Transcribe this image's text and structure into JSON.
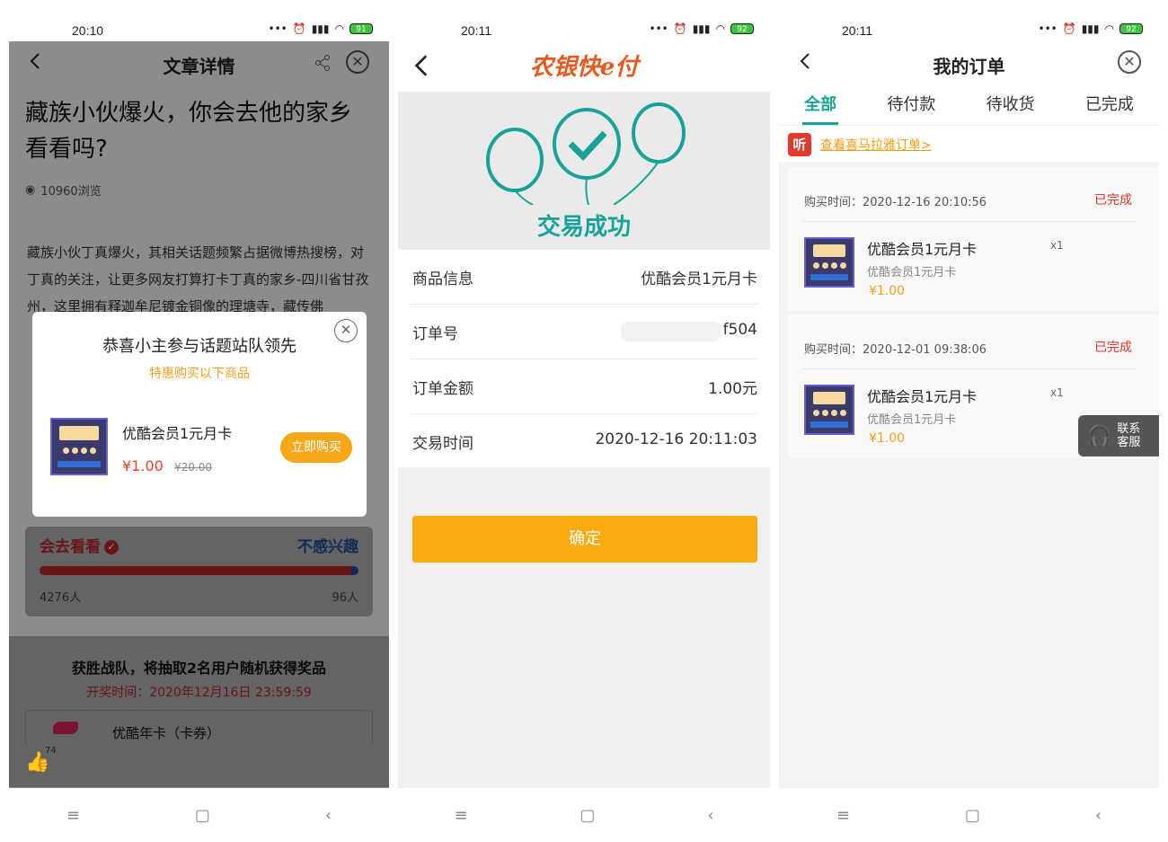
{
  "phone1": {
    "status": {
      "time": "20:10",
      "battery": "91"
    },
    "nav": {
      "title": "文章详情"
    },
    "headline": "藏族小伙爆火，你会去他的家乡看看吗?",
    "views": "10960浏览",
    "body": "藏族小伙丁真爆火，其相关话题频繁占据微博热搜榜，对丁真的关注，让更多网友打算打卡丁真的家乡-四川省甘孜州，这里拥有释迦牟尼镀金铜像的理塘寺，藏传佛",
    "modal": {
      "title": "恭喜小主参与话题站队领先",
      "subtitle": "特惠购买以下商品",
      "product_name": "优酷会员1元月卡",
      "price": "¥1.00",
      "old_price": "¥20.00",
      "buy_label": "立即购买"
    },
    "vote": {
      "left_label": "会去看看",
      "right_label": "不感兴趣",
      "left_count": "4276人",
      "right_count": "96人",
      "left_share": 0.978
    },
    "prize": {
      "title": "获胜战队，将抽取2名用户随机获得奖品",
      "draw_time": "开奖时间：2020年12月16日 23:59:59",
      "item_name": "优酷年卡（卡券）"
    },
    "likes": "74"
  },
  "phone2": {
    "status": {
      "time": "20:11",
      "battery": "92"
    },
    "brand": "农银快e付",
    "success": "交易成功",
    "rows": [
      {
        "label": "商品信息",
        "value": "优酷会员1元月卡"
      },
      {
        "label": "订单号",
        "value": "5fd9f9500c          f504"
      },
      {
        "label": "订单金额",
        "value": "1.00元"
      },
      {
        "label": "交易时间",
        "value": "2020-12-16 20:11:03"
      }
    ],
    "confirm_label": "确定"
  },
  "phone3": {
    "status": {
      "time": "20:11",
      "battery": "92"
    },
    "nav": {
      "title": "我的订单"
    },
    "tabs": [
      {
        "label": "全部"
      },
      {
        "label": "待付款"
      },
      {
        "label": "待收货"
      },
      {
        "label": "已完成"
      }
    ],
    "himalaya": {
      "badge": "听",
      "link": "查看喜马拉雅订单>"
    },
    "orders": [
      {
        "time": "购买时间：2020-12-16 20:10:56",
        "status": "已完成",
        "name": "优酷会员1元月卡",
        "sub": "优酷会员1元月卡",
        "price": "¥1.00",
        "qty": "x1"
      },
      {
        "time": "购买时间：2020-12-01 09:38:06",
        "status": "已完成",
        "name": "优酷会员1元月卡",
        "sub": "优酷会员1元月卡",
        "price": "¥1.00",
        "qty": "x1"
      }
    ],
    "service": {
      "line1": "联系",
      "line2": "客服"
    }
  }
}
